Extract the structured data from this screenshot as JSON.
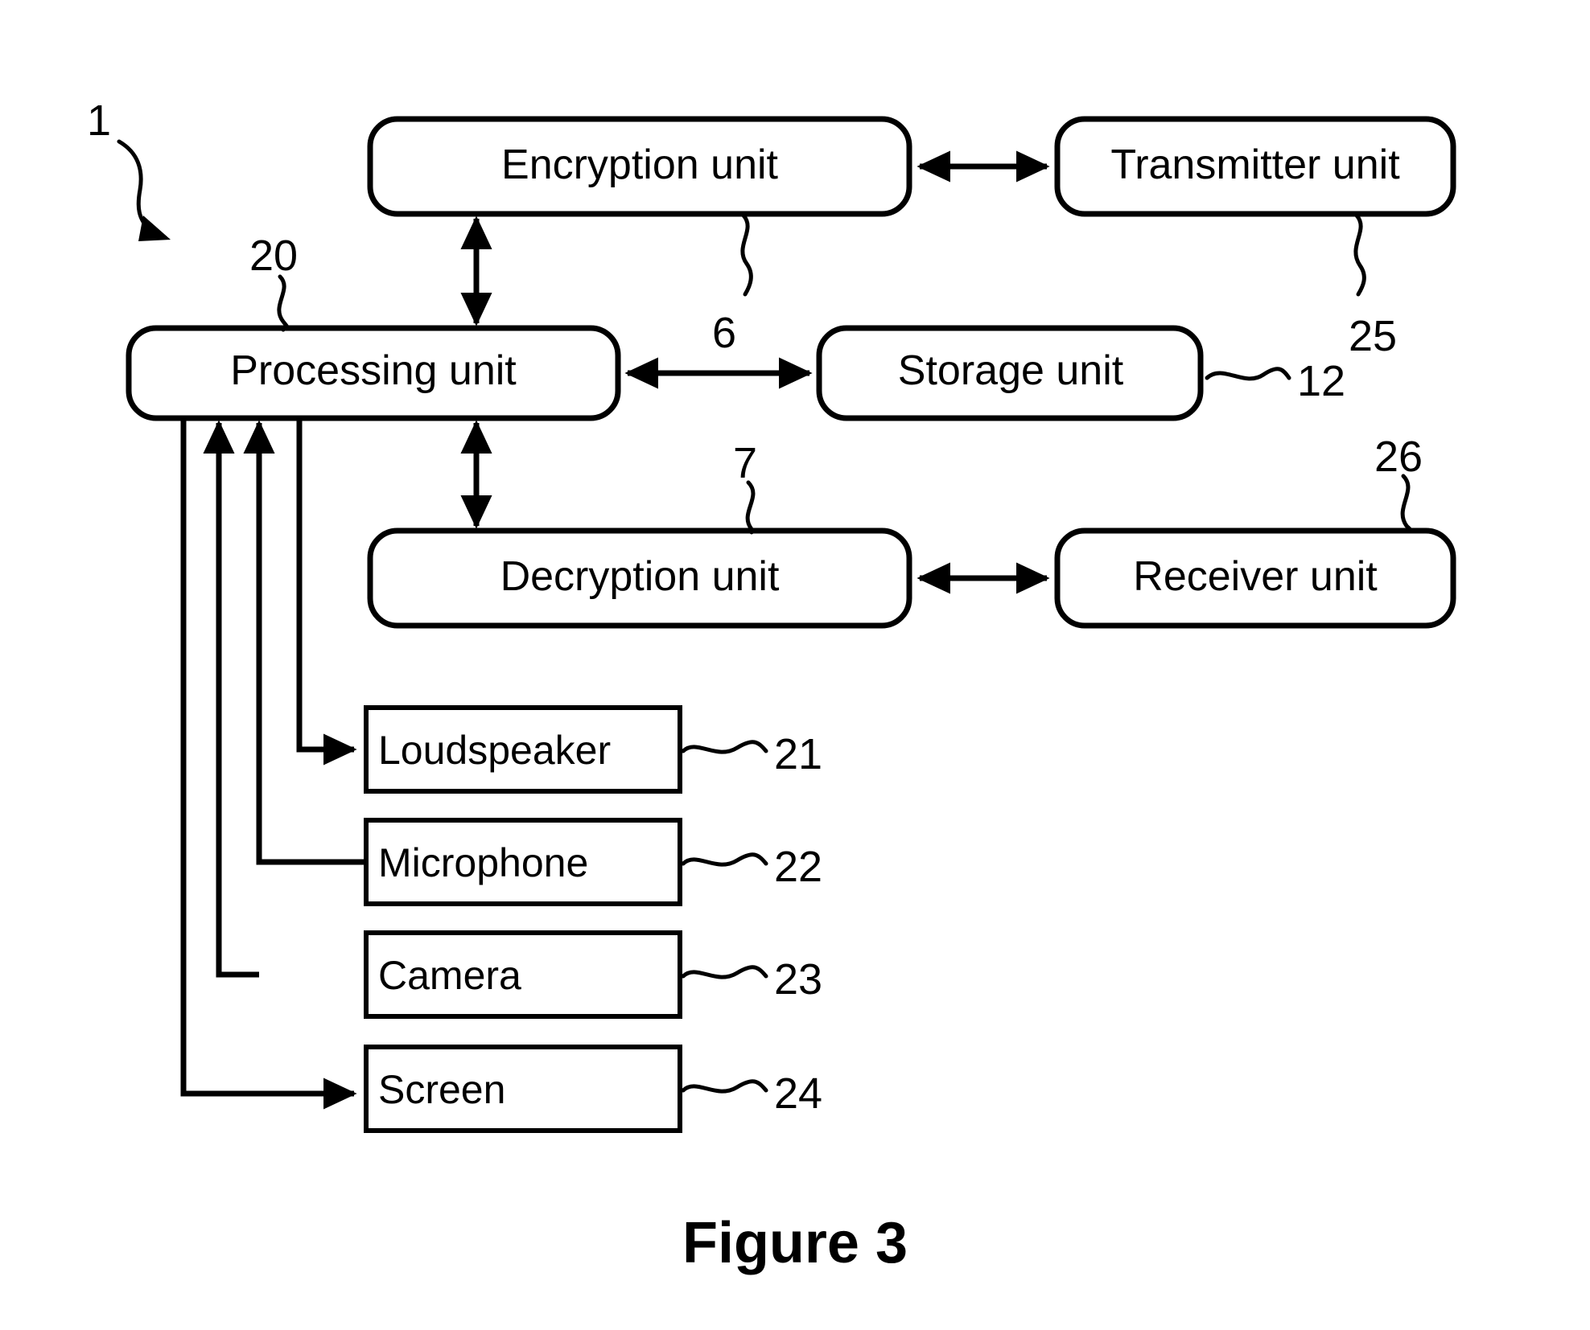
{
  "figure": {
    "caption": "Figure 3",
    "system_ref": "1"
  },
  "rounded_boxes": [
    {
      "id": "encryption",
      "label": "Encryption unit",
      "ref": "6",
      "ref_pos": "below"
    },
    {
      "id": "transmitter",
      "label": "Transmitter unit",
      "ref": "25",
      "ref_pos": "below"
    },
    {
      "id": "processing",
      "label": "Processing unit",
      "ref": "20",
      "ref_pos": "above"
    },
    {
      "id": "storage",
      "label": "Storage unit",
      "ref": "12",
      "ref_pos": "right"
    },
    {
      "id": "decryption",
      "label": "Decryption unit",
      "ref": "7",
      "ref_pos": "above"
    },
    {
      "id": "receiver",
      "label": "Receiver unit",
      "ref": "26",
      "ref_pos": "above"
    }
  ],
  "square_boxes": [
    {
      "id": "loudspeaker",
      "label": "Loudspeaker",
      "ref": "21",
      "ref_pos": "right",
      "direction": "output"
    },
    {
      "id": "microphone",
      "label": "Microphone",
      "ref": "22",
      "ref_pos": "right",
      "direction": "input"
    },
    {
      "id": "camera",
      "label": "Camera",
      "ref": "23",
      "ref_pos": "right",
      "direction": "input"
    },
    {
      "id": "screen",
      "label": "Screen",
      "ref": "24",
      "ref_pos": "right",
      "direction": "output"
    }
  ],
  "connections": [
    {
      "from": "encryption",
      "to": "transmitter",
      "type": "bidirectional",
      "orientation": "horizontal"
    },
    {
      "from": "processing",
      "to": "encryption",
      "type": "bidirectional",
      "orientation": "vertical"
    },
    {
      "from": "processing",
      "to": "storage",
      "type": "bidirectional",
      "orientation": "horizontal"
    },
    {
      "from": "processing",
      "to": "decryption",
      "type": "bidirectional",
      "orientation": "vertical"
    },
    {
      "from": "decryption",
      "to": "receiver",
      "type": "bidirectional",
      "orientation": "horizontal"
    },
    {
      "from": "processing",
      "to": "loudspeaker",
      "type": "unidirectional",
      "orientation": "bus"
    },
    {
      "from": "microphone",
      "to": "processing",
      "type": "unidirectional",
      "orientation": "bus"
    },
    {
      "from": "camera",
      "to": "processing",
      "type": "unidirectional",
      "orientation": "bus"
    },
    {
      "from": "processing",
      "to": "screen",
      "type": "unidirectional",
      "orientation": "bus"
    }
  ],
  "colors": {
    "stroke": "#000000",
    "fill": "#ffffff",
    "background": "#ffffff"
  }
}
